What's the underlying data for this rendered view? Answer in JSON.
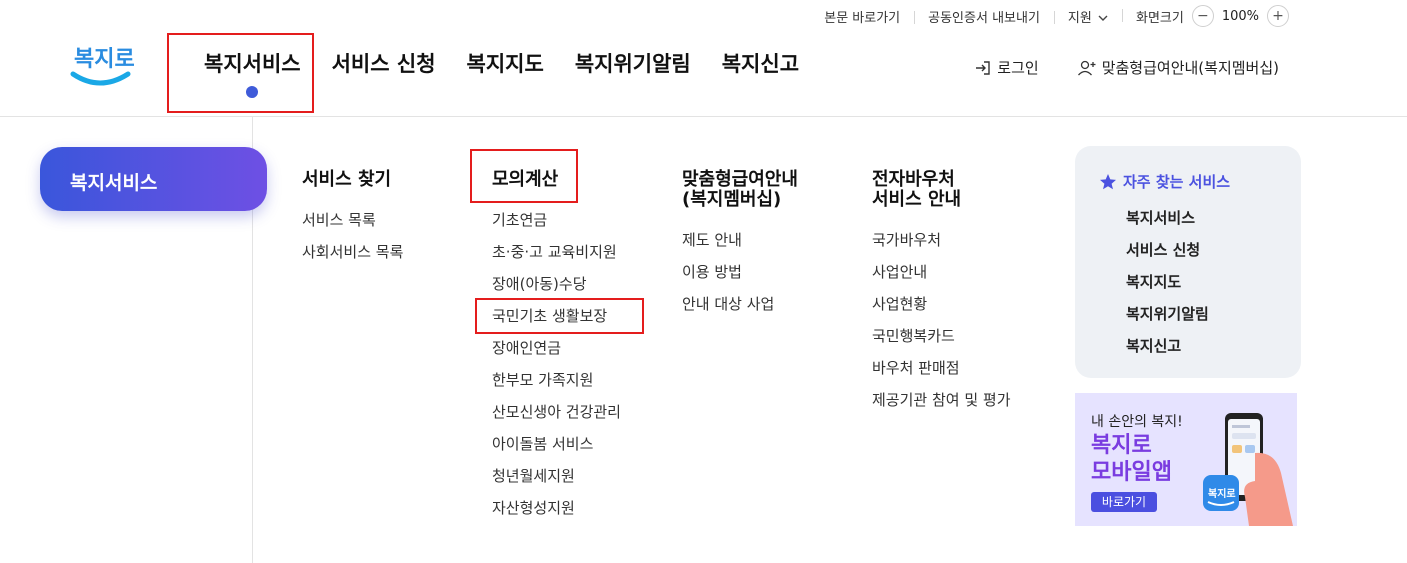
{
  "utility": {
    "skip_link": "본문 바로가기",
    "cert_export": "공동인증서 내보내기",
    "support": "지원",
    "zoom_label": "화면크기",
    "zoom_value": "100%",
    "zoom_out": "−",
    "zoom_in": "+"
  },
  "logo": {
    "text": "복지로"
  },
  "gnb": [
    {
      "label": "복지서비스"
    },
    {
      "label": "서비스 신청"
    },
    {
      "label": "복지지도"
    },
    {
      "label": "복지위기알림"
    },
    {
      "label": "복지신고"
    }
  ],
  "header_right": {
    "login": "로그인",
    "custom_info": "맞춤형급여안내(복지멤버십)"
  },
  "side_pill": "복지서비스",
  "columns": [
    {
      "title": "서비스 찾기",
      "items": [
        "서비스 목록",
        "사회서비스 목록"
      ]
    },
    {
      "title": "모의계산",
      "items": [
        "기초연금",
        "초·중·고 교육비지원",
        "장애(아동)수당",
        "국민기초 생활보장",
        "장애인연금",
        "한부모 가족지원",
        "산모신생아 건강관리",
        "아이돌봄 서비스",
        "청년월세지원",
        "자산형성지원"
      ]
    },
    {
      "title": "맞춤형급여안내\n(복지멤버십)",
      "items": [
        "제도 안내",
        "이용 방법",
        "안내 대상 사업"
      ]
    },
    {
      "title": "전자바우처\n서비스 안내",
      "items": [
        "국가바우처",
        "사업안내",
        "사업현황",
        "국민행복카드",
        "바우처 판매점",
        "제공기관 참여 및 평가"
      ]
    }
  ],
  "favorites": {
    "title": "자주 찾는 서비스",
    "items": [
      "복지서비스",
      "서비스 신청",
      "복지지도",
      "복지위기알림",
      "복지신고"
    ]
  },
  "banner": {
    "line1": "내 손안의 복지!",
    "line2": "복지로",
    "line3": "모바일앱",
    "button": "바로가기"
  },
  "colors": {
    "accent": "#3f5bd9",
    "highlight_box": "#e41d1d",
    "favorite_title": "#4b52e0"
  }
}
